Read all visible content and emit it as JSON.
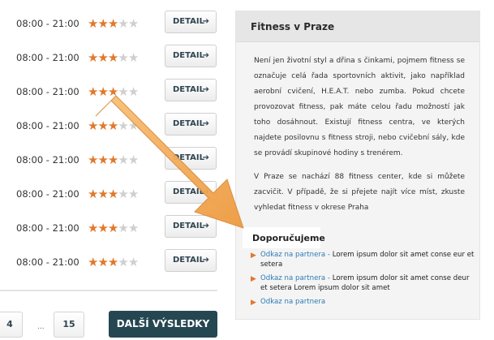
{
  "rows": [
    {
      "time": "08:00 - 21:00",
      "stars_on": 3,
      "stars_total": 5,
      "detail_label": "DETAIL",
      "arrow": "➔"
    },
    {
      "time": "08:00 - 21:00",
      "stars_on": 3,
      "stars_total": 5,
      "detail_label": "DETAIL",
      "arrow": "➔"
    },
    {
      "time": "08:00 - 21:00",
      "stars_on": 3,
      "stars_total": 5,
      "detail_label": "DETAIL",
      "arrow": "➔"
    },
    {
      "time": "08:00 - 21:00",
      "stars_on": 3,
      "stars_total": 5,
      "detail_label": "DETAIL",
      "arrow": "➔"
    },
    {
      "time": "08:00 - 21:00",
      "stars_on": 3,
      "stars_total": 5,
      "detail_label": "DETAIL",
      "arrow": "➔"
    },
    {
      "time": "08:00 - 21:00",
      "stars_on": 3,
      "stars_total": 5,
      "detail_label": "DETAIL",
      "arrow": "➔"
    },
    {
      "time": "08:00 - 21:00",
      "stars_on": 3,
      "stars_total": 5,
      "detail_label": "DETAIL",
      "arrow": "➔"
    },
    {
      "time": "08:00 - 21:00",
      "stars_on": 3,
      "stars_total": 5,
      "detail_label": "DETAIL",
      "arrow": "➔"
    }
  ],
  "pagination": {
    "page_a": "4",
    "ellipsis": "...",
    "page_b": "15",
    "more_label": "DALŠÍ VÝSLEDKY"
  },
  "panel": {
    "title": "Fitness v Praze",
    "paragraph1": "Není jen životní styl a dřina s činkami, pojmem fitness se označuje celá řada sportovních aktivit, jako například aerobní cvičení, H.E.A.T. nebo zumba. Pokud chcete provozovat fitness, pak máte celou řadu možností jak toho dosáhnout. Existují fitness centra, ve kterých najdete posilovnu s fitness stroji, nebo cvičební sály, kde se provádí skupinové hodiny s trenérem.",
    "paragraph2": "V Praze se nachází 88 fitness center, kde si můžete zacvičit. V případě, že si přejete najít více míst, zkuste vyhledat fitness v okrese Praha",
    "recommend_title": "Doporučujeme",
    "links": [
      {
        "link": "Odkaz na partnera",
        "sep": " - ",
        "text": "Lorem ipsum dolor sit amet conse eur et setera"
      },
      {
        "link": "Odkaz na partnera",
        "sep": " - ",
        "text": "Lorem ipsum dolor sit amet conse deur et setera Lorem ipsum dolor sit amet"
      },
      {
        "link": "Odkaz na partnera",
        "sep": "",
        "text": ""
      }
    ]
  },
  "icons": {
    "star": "★",
    "bullet": "▶"
  },
  "colors": {
    "accent": "#e0792c",
    "dark_button": "#254752",
    "link": "#2c7bb6",
    "arrow_fill": "#f0a24a"
  }
}
